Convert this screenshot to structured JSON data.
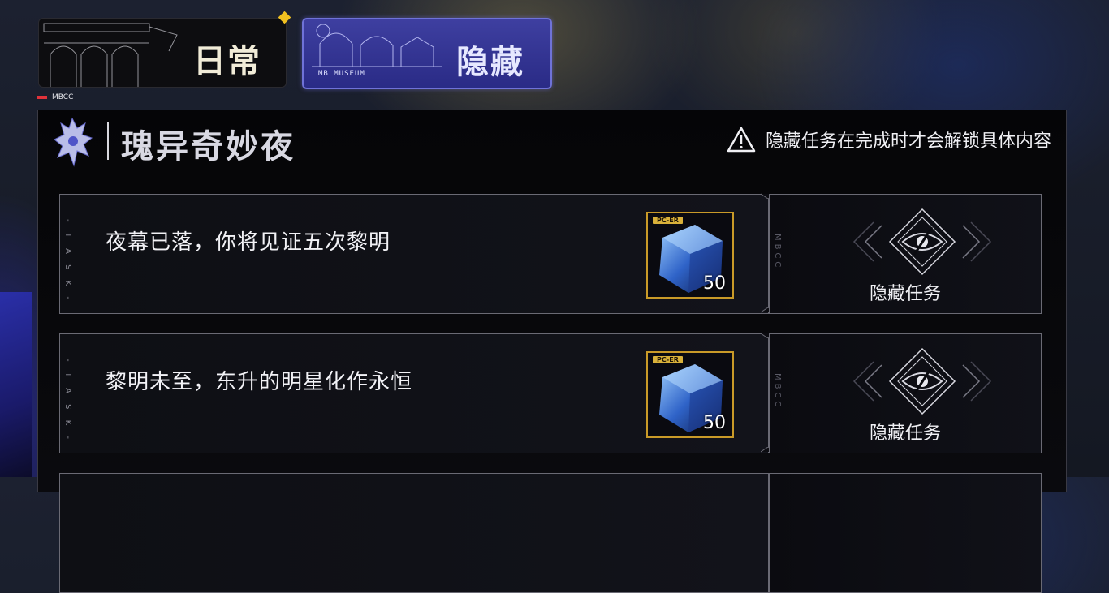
{
  "tabs": [
    {
      "label": "日常",
      "active": false
    },
    {
      "label": "隐藏",
      "active": true,
      "barcode": "MB MUSEUM"
    }
  ],
  "new_badge_color": "#f0c020",
  "header_tag": "MBCC",
  "panel": {
    "title": "瑰异奇妙夜",
    "notice": "隐藏任务在完成时才会解锁具体内容",
    "notice_icon": "warning-triangle-icon"
  },
  "tasks": [
    {
      "stripe": "- T A S K -",
      "text": "夜幕已落，你将见证五次黎明",
      "reward": {
        "tag": "PC-ER",
        "count": "50",
        "icon": "crystal-cube-icon"
      },
      "side_mark": "MBCC",
      "status": "隐藏任务",
      "status_icon": "eye-diamond-icon"
    },
    {
      "stripe": "- T A S K -",
      "text": "黎明未至，东升的明星化作永恒",
      "reward": {
        "tag": "PC-ER",
        "count": "50",
        "icon": "crystal-cube-icon"
      },
      "side_mark": "MBCC",
      "status": "隐藏任务",
      "status_icon": "eye-diamond-icon"
    }
  ],
  "colors": {
    "accent_tab": "#3e3fa0",
    "reward_border": "#c99a28",
    "tag_red": "#e0323a"
  }
}
